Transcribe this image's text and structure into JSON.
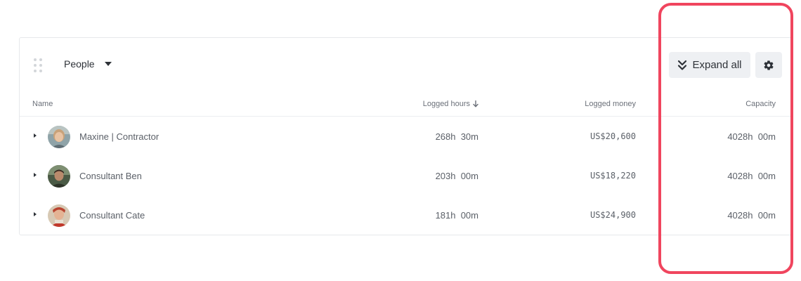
{
  "header": {
    "group_by_label": "People",
    "expand_all_label": "Expand all"
  },
  "table": {
    "columns": {
      "name": "Name",
      "logged_hours": "Logged hours",
      "logged_money": "Logged money",
      "capacity": "Capacity"
    },
    "sort": {
      "column": "logged_hours",
      "direction": "descending"
    },
    "rows": [
      {
        "name": "Maxine | Contractor",
        "logged_hours": "268h  30m",
        "logged_money": "US$20,600",
        "capacity": "4028h  00m"
      },
      {
        "name": "Consultant Ben",
        "logged_hours": "203h  00m",
        "logged_money": "US$18,220",
        "capacity": "4028h  00m"
      },
      {
        "name": "Consultant Cate",
        "logged_hours": "181h  00m",
        "logged_money": "US$24,900",
        "capacity": "4028h  00m"
      }
    ]
  },
  "icons": {
    "drag_handle": "drag-handle-icon",
    "dropdown": "caret-down-icon",
    "expand_all": "double-chevron-down-icon",
    "settings": "gear-icon",
    "sort": "arrow-down-icon",
    "row_expand": "caret-right-icon"
  },
  "colors": {
    "highlight_border": "#f0455e",
    "button_bg": "#eef0f3",
    "text_primary": "#2e3238",
    "text_secondary": "#5b6068"
  }
}
